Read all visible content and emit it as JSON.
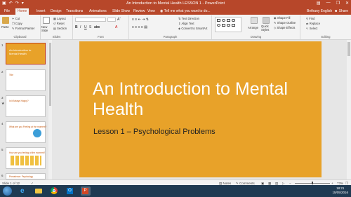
{
  "app": {
    "window_title": "An Introduction to Mental Health LESSON 1 - PowerPoint",
    "accent_color": "#b7472a",
    "slide_color": "#e8a229"
  },
  "ribbon_tabs": {
    "file": "File",
    "home": "Home",
    "insert": "Insert",
    "design": "Design",
    "transitions": "Transitions",
    "animations": "Animations",
    "slideshow": "Slide Show",
    "review": "Review",
    "view": "View",
    "tell_me": "Tell me what you want to do...",
    "user": "Bethany English",
    "share": "Share"
  },
  "ribbon": {
    "clipboard": {
      "paste": "Paste",
      "cut": "Cut",
      "copy": "Copy",
      "format_painter": "Format Painter",
      "label": "Clipboard"
    },
    "slides": {
      "new_slide": "New Slide",
      "layout": "Layout",
      "reset": "Reset",
      "section": "Section",
      "label": "Slides"
    },
    "font": {
      "label": "Font"
    },
    "paragraph": {
      "text_direction": "Text Direction",
      "align_text": "Align Text",
      "convert_smartart": "Convert to SmartArt",
      "label": "Paragraph"
    },
    "drawing": {
      "arrange": "Arrange",
      "quick_styles": "Quick Styles",
      "shape_fill": "Shape Fill",
      "shape_outline": "Shape Outline",
      "shape_effects": "Shape Effects",
      "label": "Drawing"
    },
    "editing": {
      "find": "Find",
      "replace": "Replace",
      "select": "Select",
      "label": "Editing"
    }
  },
  "thumbnails": [
    {
      "num": "1",
      "text": "An Introduction to Mental Health"
    },
    {
      "num": "2",
      "text": "Title"
    },
    {
      "num": "3",
      "text": "Is it Always Happy?"
    },
    {
      "num": "4",
      "text": "What are you Feeling at the moment?"
    },
    {
      "num": "5",
      "text": "How are you feeling at the moment?"
    },
    {
      "num": "6",
      "text": "Prevalence: Psychology"
    }
  ],
  "slide": {
    "title": "An Introduction to Mental Health",
    "subtitle": "Lesson 1 – Psychological Problems"
  },
  "status": {
    "slide_counter": "Slide 1 of 12",
    "notes": "Notes",
    "comments": "Comments",
    "zoom": "73%"
  },
  "tray": {
    "time": "18:21",
    "date": "15/05/2016"
  }
}
